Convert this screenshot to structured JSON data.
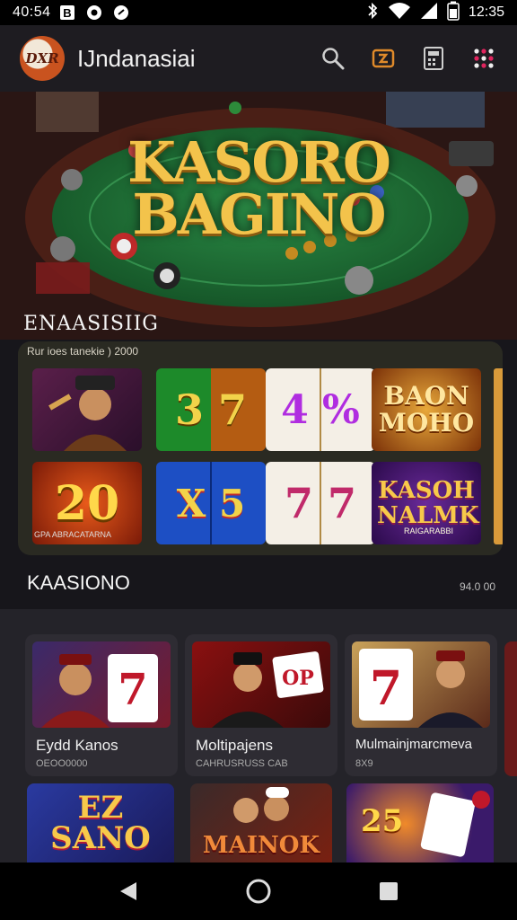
{
  "status_bar": {
    "time": "40:54",
    "right_time": "12:35"
  },
  "app_bar": {
    "logo_text": "DXR",
    "title": "IJndanasiai"
  },
  "hero": {
    "line1": "KASORO",
    "line2": "BAGINO"
  },
  "section1": {
    "title": "ENAASISIIG",
    "caption": "Rur ioes tanekie ) 2000"
  },
  "slots": [
    {
      "label": "",
      "kind": "character"
    },
    {
      "label": "3 7",
      "kind": "reel"
    },
    {
      "label": "4 %",
      "kind": "reel"
    },
    {
      "label": "BAON MOHO",
      "kind": "banner"
    },
    {
      "label": "20",
      "kind": "number"
    },
    {
      "label": "X 5",
      "kind": "reel"
    },
    {
      "label": "7 7",
      "kind": "reel"
    },
    {
      "label": "KASOH NALMK",
      "kind": "banner"
    }
  ],
  "slot_captions": {
    "tile5": "GPA ABRACATARNA",
    "tile8": "RAIGARABBI"
  },
  "section2": {
    "title": "KAASIONO",
    "meta": "94.0 00"
  },
  "cards": [
    {
      "title": "Eydd Kanos",
      "sub": "OEOO0000"
    },
    {
      "title": "Moltipajens",
      "sub": "CAHRUSRUSS CAB"
    },
    {
      "title": "Mulmainjmarcmeva",
      "sub": "8X9"
    }
  ],
  "bottom_row": {
    "tile1": "EZ SANO",
    "tile2": "MAINOK",
    "tile3": "25"
  },
  "colors": {
    "accent_gold": "#f3c34b",
    "felt_green": "#1f6b33",
    "table_rim": "#4a1f16"
  }
}
